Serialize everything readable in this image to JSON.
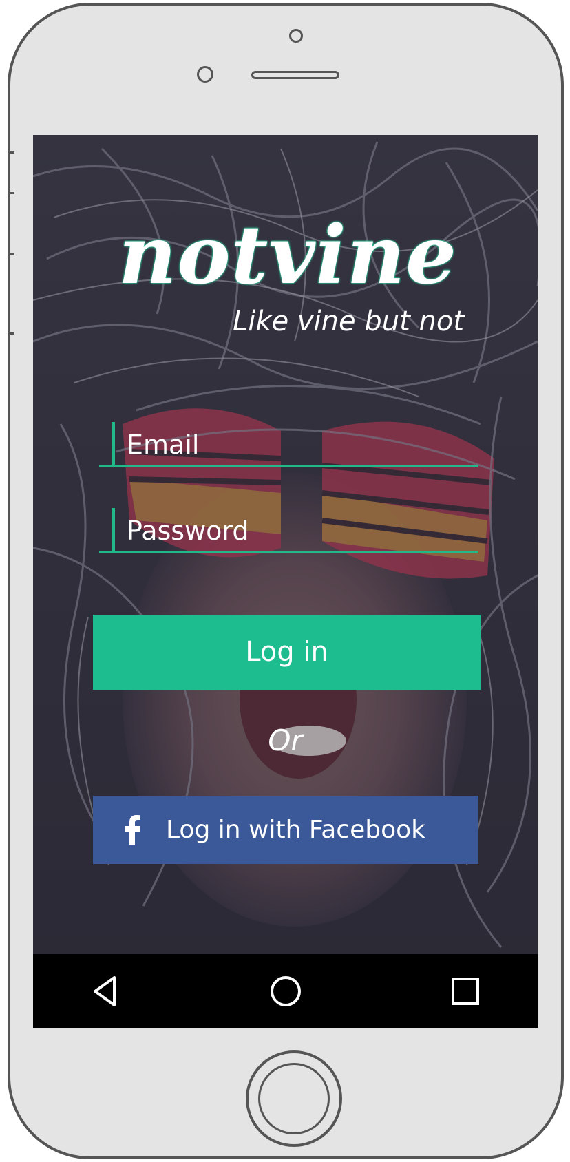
{
  "app": {
    "logo_text": "notvine",
    "tagline": "Like vine but not"
  },
  "login_form": {
    "email_placeholder": "Email",
    "password_placeholder": "Password",
    "login_button_label": "Log in",
    "separator_text": "Or",
    "facebook_button_label": "Log in with Facebook"
  },
  "system_nav": {
    "back_icon": "back-triangle-icon",
    "home_icon": "home-circle-icon",
    "recent_icon": "recent-apps-square-icon"
  },
  "colors": {
    "accent": "#1dbd8f",
    "facebook": "#3b5998",
    "nav_bar": "#000000",
    "device_frame": "#e4e4e4"
  }
}
